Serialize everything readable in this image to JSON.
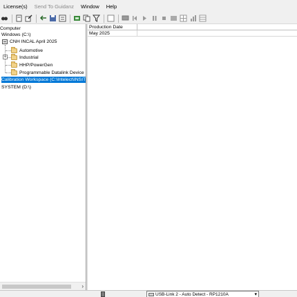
{
  "menu": [
    {
      "label": "License(s)",
      "disabled": false
    },
    {
      "label": "Send To Guidanz",
      "disabled": true
    },
    {
      "label": "Window",
      "disabled": false
    },
    {
      "label": "Help",
      "disabled": false
    }
  ],
  "tree": {
    "computer": "Computer",
    "windows_drive": "Windows  (C:\\)",
    "root_item": "CNH INCAL April 2025",
    "children": [
      "Automotive",
      "Industrial",
      "HHP/PowerGen",
      "Programmable Datalink Device"
    ],
    "selected_item": "Calibration Workspace  (C:\\Intelect\\INSITE\\Calibration",
    "system_drive": "SYSTEM  (D:\\)"
  },
  "grid": {
    "column_header": "Production Date",
    "rows": [
      "May 2025"
    ]
  },
  "statusbar": {
    "adapter": "USB-Link 2 - Auto Detect - RP1210A"
  }
}
